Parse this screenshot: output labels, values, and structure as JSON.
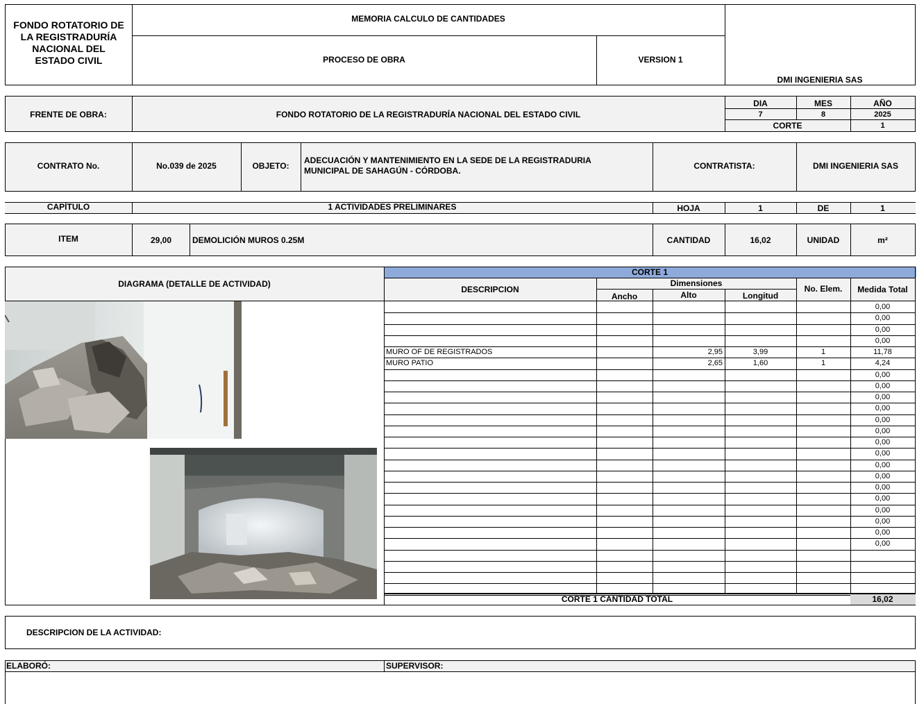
{
  "header": {
    "entity": [
      "FONDO ROTATORIO DE",
      "LA REGISTRADURÍA",
      "NACIONAL DEL",
      "ESTADO CIVIL"
    ],
    "doc_title": "MEMORIA CALCULO DE CANTIDADES",
    "process": "PROCESO DE OBRA",
    "version": "VERSION 1",
    "company": "DMI INGENIERIA SAS"
  },
  "front": {
    "label": "FRENTE DE OBRA:",
    "value": "FONDO ROTATORIO DE LA REGISTRADURÍA NACIONAL DEL ESTADO CIVIL",
    "dia_label": "DIA",
    "mes_label": "MES",
    "anio_label": "AÑO",
    "dia": "7",
    "mes": "8",
    "anio": "2025",
    "corte_label": "CORTE",
    "corte": "1"
  },
  "contract": {
    "label": "CONTRATO No.",
    "number": "No.039 de 2025",
    "objeto_label": "OBJETO:",
    "objeto_line1": "ADECUACIÓN  Y  MANTENIMIENTO  EN  LA  SEDE  DE  LA  REGISTRADURIA",
    "objeto_line2": "MUNICIPAL DE SAHAGÚN  - CÓRDOBA.",
    "contratista_label": "CONTRATISTA:",
    "contratista": "DMI INGENIERIA SAS"
  },
  "chapter": {
    "label": "CAPÍTULO",
    "value": "1  ACTIVIDADES PRELIMINARES",
    "hoja_label": "HOJA",
    "hoja": "1",
    "de_label": "DE",
    "de": "1"
  },
  "item": {
    "label": "ITEM",
    "number": "29,00",
    "description": "DEMOLICIÓN MUROS 0.25M",
    "cantidad_label": "CANTIDAD",
    "cantidad": "16,02",
    "unidad_label": "UNIDAD",
    "unidad": "m²"
  },
  "diagram": {
    "title": "DIAGRAMA (DETALLE DE ACTIVIDAD)"
  },
  "table": {
    "corte_title": "CORTE 1",
    "descripcion_header": "DESCRIPCION",
    "dimensiones_header": "Dimensiones",
    "ancho_header": "Ancho",
    "alto_header": "Alto",
    "longitud_header": "Longitud",
    "elem_header": "No. Elem.",
    "total_header": "Medida Total",
    "rows": [
      {
        "desc": "",
        "ancho": "",
        "alto": "",
        "long": "",
        "elem": "",
        "total": "0,00"
      },
      {
        "desc": "",
        "ancho": "",
        "alto": "",
        "long": "",
        "elem": "",
        "total": "0,00"
      },
      {
        "desc": "",
        "ancho": "",
        "alto": "",
        "long": "",
        "elem": "",
        "total": "0,00"
      },
      {
        "desc": "",
        "ancho": "",
        "alto": "",
        "long": "",
        "elem": "",
        "total": "0,00"
      },
      {
        "desc": "MURO OF DE REGISTRADOS",
        "ancho": "",
        "alto": "2,95",
        "long": "3,99",
        "elem": "1",
        "total": "11,78"
      },
      {
        "desc": "MURO PATIO",
        "ancho": "",
        "alto": "2,65",
        "long": "1,60",
        "elem": "1",
        "total": "4,24"
      },
      {
        "desc": "",
        "ancho": "",
        "alto": "",
        "long": "",
        "elem": "",
        "total": "0,00"
      },
      {
        "desc": "",
        "ancho": "",
        "alto": "",
        "long": "",
        "elem": "",
        "total": "0,00"
      },
      {
        "desc": "",
        "ancho": "",
        "alto": "",
        "long": "",
        "elem": "",
        "total": "0,00"
      },
      {
        "desc": "",
        "ancho": "",
        "alto": "",
        "long": "",
        "elem": "",
        "total": "0,00"
      },
      {
        "desc": "",
        "ancho": "",
        "alto": "",
        "long": "",
        "elem": "",
        "total": "0,00"
      },
      {
        "desc": "",
        "ancho": "",
        "alto": "",
        "long": "",
        "elem": "",
        "total": "0,00"
      },
      {
        "desc": "",
        "ancho": "",
        "alto": "",
        "long": "",
        "elem": "",
        "total": "0,00"
      },
      {
        "desc": "",
        "ancho": "",
        "alto": "",
        "long": "",
        "elem": "",
        "total": "0,00"
      },
      {
        "desc": "",
        "ancho": "",
        "alto": "",
        "long": "",
        "elem": "",
        "total": "0,00"
      },
      {
        "desc": "",
        "ancho": "",
        "alto": "",
        "long": "",
        "elem": "",
        "total": "0,00"
      },
      {
        "desc": "",
        "ancho": "",
        "alto": "",
        "long": "",
        "elem": "",
        "total": "0,00"
      },
      {
        "desc": "",
        "ancho": "",
        "alto": "",
        "long": "",
        "elem": "",
        "total": "0,00"
      },
      {
        "desc": "",
        "ancho": "",
        "alto": "",
        "long": "",
        "elem": "",
        "total": "0,00"
      },
      {
        "desc": "",
        "ancho": "",
        "alto": "",
        "long": "",
        "elem": "",
        "total": "0,00"
      },
      {
        "desc": "",
        "ancho": "",
        "alto": "",
        "long": "",
        "elem": "",
        "total": "0,00"
      },
      {
        "desc": "",
        "ancho": "",
        "alto": "",
        "long": "",
        "elem": "",
        "total": "0,00"
      },
      {
        "desc": "",
        "ancho": "",
        "alto": "",
        "long": "",
        "elem": "",
        "total": ""
      },
      {
        "desc": "",
        "ancho": "",
        "alto": "",
        "long": "",
        "elem": "",
        "total": ""
      },
      {
        "desc": "",
        "ancho": "",
        "alto": "",
        "long": "",
        "elem": "",
        "total": ""
      },
      {
        "desc": "",
        "ancho": "",
        "alto": "",
        "long": "",
        "elem": "",
        "total": ""
      }
    ],
    "total_label": "CORTE 1 CANTIDAD TOTAL",
    "total_value": "16,02"
  },
  "activity": {
    "label": "DESCRIPCION DE LA ACTIVIDAD:"
  },
  "signatures": {
    "elaboro": "ELABORÓ:",
    "supervisor": "SUPERVISOR:"
  },
  "colors": {
    "corte_header": "#8eaadb",
    "gray_fill": "#f2f2f2",
    "total_fill": "#d9d9d9"
  }
}
